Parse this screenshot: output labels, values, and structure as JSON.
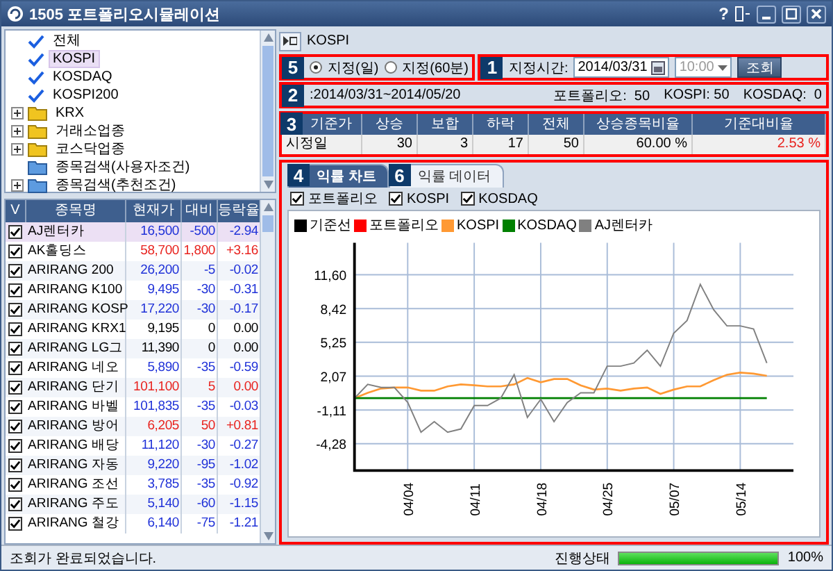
{
  "window": {
    "title": "1505 포트폴리오시뮬레이션",
    "help": "?"
  },
  "tree": [
    {
      "label": "전체",
      "kind": "check",
      "checked": true,
      "selected": false
    },
    {
      "label": "KOSPI",
      "kind": "check",
      "checked": true,
      "selected": true
    },
    {
      "label": "KOSDAQ",
      "kind": "check",
      "checked": true,
      "selected": false
    },
    {
      "label": "KOSPI200",
      "kind": "check",
      "checked": true,
      "selected": false
    },
    {
      "label": "KRX",
      "kind": "folder",
      "expandable": true,
      "selected": false
    },
    {
      "label": "거래소업종",
      "kind": "folder",
      "expandable": true,
      "selected": false
    },
    {
      "label": "코스닥업종",
      "kind": "folder",
      "expandable": true,
      "selected": false
    },
    {
      "label": "종목검색(사용자조건)",
      "kind": "search",
      "expandable": false,
      "selected": false
    },
    {
      "label": "종목검색(추천조건)",
      "kind": "search",
      "expandable": true,
      "selected": false
    }
  ],
  "stocks": {
    "columns": [
      "V",
      "종목명",
      "현재가",
      "대비",
      "등락율"
    ],
    "rows": [
      {
        "checked": true,
        "selected": true,
        "color": "#1f31d8",
        "name": "AJ렌터카",
        "price": "16,500",
        "change": "-500",
        "rate": "-2.94"
      },
      {
        "checked": true,
        "selected": false,
        "color": "#e8231f",
        "name": "AK홀딩스",
        "price": "58,700",
        "change": "1,800",
        "rate": "+3.16"
      },
      {
        "checked": true,
        "selected": false,
        "color": "#1f31d8",
        "name": "ARIRANG 200",
        "price": "26,200",
        "change": "-5",
        "rate": "-0.02"
      },
      {
        "checked": true,
        "selected": false,
        "color": "#1f31d8",
        "name": "ARIRANG K100",
        "price": "9,495",
        "change": "-30",
        "rate": "-0.31"
      },
      {
        "checked": true,
        "selected": false,
        "color": "#1f31d8",
        "name": "ARIRANG KOSP",
        "price": "17,220",
        "change": "-30",
        "rate": "-0.17"
      },
      {
        "checked": true,
        "selected": false,
        "color": "#000000",
        "name": "ARIRANG KRX1",
        "price": "9,195",
        "change": "0",
        "rate": "0.00"
      },
      {
        "checked": true,
        "selected": false,
        "color": "#000000",
        "name": "ARIRANG LG그",
        "price": "11,390",
        "change": "0",
        "rate": "0.00"
      },
      {
        "checked": true,
        "selected": false,
        "color": "#1f31d8",
        "name": "ARIRANG 네오",
        "price": "5,890",
        "change": "-35",
        "rate": "-0.59"
      },
      {
        "checked": true,
        "selected": false,
        "color": "#e8231f",
        "name": "ARIRANG 단기",
        "price": "101,100",
        "change": "5",
        "rate": "0.00"
      },
      {
        "checked": true,
        "selected": false,
        "color": "#1f31d8",
        "name": "ARIRANG 바벨",
        "price": "101,835",
        "change": "-35",
        "rate": "-0.03"
      },
      {
        "checked": true,
        "selected": false,
        "color": "#e8231f",
        "name": "ARIRANG 방어",
        "price": "6,205",
        "change": "50",
        "rate": "+0.81"
      },
      {
        "checked": true,
        "selected": false,
        "color": "#1f31d8",
        "name": "ARIRANG 배당",
        "price": "11,120",
        "change": "-30",
        "rate": "-0.27"
      },
      {
        "checked": true,
        "selected": false,
        "color": "#1f31d8",
        "name": "ARIRANG 자동",
        "price": "9,220",
        "change": "-95",
        "rate": "-1.02"
      },
      {
        "checked": true,
        "selected": false,
        "color": "#1f31d8",
        "name": "ARIRANG 조선",
        "price": "3,785",
        "change": "-35",
        "rate": "-0.92"
      },
      {
        "checked": true,
        "selected": false,
        "color": "#1f31d8",
        "name": "ARIRANG 주도",
        "price": "5,140",
        "change": "-60",
        "rate": "-1.15"
      },
      {
        "checked": true,
        "selected": false,
        "color": "#1f31d8",
        "name": "ARIRANG 철강",
        "price": "6,140",
        "change": "-75",
        "rate": "-1.21"
      }
    ]
  },
  "header": {
    "market": "KOSPI"
  },
  "badges": [
    "5",
    "1",
    "2",
    "3",
    "4",
    "6"
  ],
  "query": {
    "radios": [
      {
        "label": "지정(일)",
        "selected": true
      },
      {
        "label": "지정(60분)",
        "selected": false
      }
    ],
    "time_label": "지정시간:",
    "date": "2014/03/31",
    "time": "10:00",
    "time_disabled": true,
    "button": "조회"
  },
  "period": {
    "range": ":2014/03/31~2014/05/20",
    "counts": [
      "포트폴리오:  50",
      "KOSPI: 50",
      "KOSDAQ:  0"
    ]
  },
  "summary": {
    "columns": [
      "기준가",
      "상승",
      "보합",
      "하락",
      "전체",
      "상승종목비율",
      "기준대비율"
    ],
    "row": [
      {
        "text": "시정일",
        "color": "#000000"
      },
      {
        "text": "30",
        "color": "#000000"
      },
      {
        "text": "3",
        "color": "#000000"
      },
      {
        "text": "17",
        "color": "#000000"
      },
      {
        "text": "50",
        "color": "#000000"
      },
      {
        "text": "60.00 %",
        "color": "#000000"
      },
      {
        "text": "2.53 %",
        "color": "#e8231f"
      }
    ]
  },
  "tabs": [
    {
      "label": "익률 차트",
      "selected": true
    },
    {
      "label": "익률 데이터",
      "selected": false
    }
  ],
  "toggles": [
    {
      "label": "포트폴리오",
      "checked": true
    },
    {
      "label": "KOSPI",
      "checked": true
    },
    {
      "label": "KOSDAQ",
      "checked": true
    }
  ],
  "chart": {
    "chart_data": {
      "type": "line",
      "categories": [
        null,
        null,
        null,
        null,
        "04/04",
        null,
        null,
        null,
        null,
        "04/11",
        null,
        null,
        null,
        null,
        "04/18",
        null,
        null,
        null,
        null,
        "04/25",
        null,
        null,
        null,
        null,
        "05/07",
        null,
        null,
        null,
        null,
        "05/14",
        null,
        null
      ],
      "ylim": [
        -6.8,
        14.6
      ],
      "grid": true,
      "yticks": [
        {
          "value": -4.28,
          "label": "-4,28"
        },
        {
          "value": -1.11,
          "label": "-1,11"
        },
        {
          "value": 2.07,
          "label": "2,07"
        },
        {
          "value": 5.25,
          "label": "5,25"
        },
        {
          "value": 8.42,
          "label": "8,42"
        },
        {
          "value": 11.6,
          "label": "11,60"
        }
      ],
      "series": [
        {
          "name": "기준선",
          "color": "#000000",
          "values": [
            null,
            null,
            null,
            null,
            null,
            null,
            null,
            null,
            null,
            null,
            null,
            null,
            null,
            null,
            null,
            null,
            null,
            null,
            null,
            null,
            null,
            null,
            null,
            null,
            null,
            null,
            null,
            null,
            null,
            null,
            null,
            null
          ]
        },
        {
          "name": "포트폴리오",
          "color": "#ff0000",
          "values": [
            null,
            null,
            null,
            null,
            null,
            null,
            null,
            null,
            null,
            null,
            null,
            null,
            null,
            null,
            null,
            null,
            null,
            null,
            null,
            null,
            null,
            null,
            null,
            null,
            null,
            null,
            null,
            null,
            null,
            null,
            null,
            null
          ]
        },
        {
          "name": "KOSPI",
          "color": "#ff9933",
          "values": [
            0,
            0.5,
            0.9,
            1.0,
            1.0,
            0.7,
            0.7,
            1.1,
            1.3,
            1.2,
            1.1,
            1.1,
            1.3,
            1.9,
            1.5,
            1.8,
            1.8,
            1.2,
            0.8,
            0.9,
            0.7,
            0.9,
            1.0,
            0.4,
            0.8,
            1.1,
            1.1,
            1.7,
            2.2,
            2.4,
            2.3,
            2.1
          ]
        },
        {
          "name": "KOSDAQ",
          "color": "#008000",
          "values": [
            0,
            0,
            0,
            0,
            0,
            0,
            0,
            0,
            0,
            0,
            0,
            0,
            0,
            0,
            0,
            0,
            0,
            0,
            0,
            0,
            0,
            0,
            0,
            0,
            0,
            0,
            0,
            0,
            0,
            0,
            0,
            0
          ]
        },
        {
          "name": "AJ렌터카",
          "color": "#808080",
          "values": [
            0,
            1.3,
            1.0,
            1.0,
            -0.4,
            -3.2,
            -2.2,
            -3.2,
            -2.9,
            -0.7,
            -0.7,
            0.0,
            2.2,
            -1.8,
            -0.1,
            -2.2,
            -0.4,
            0.5,
            0.5,
            3.0,
            3.0,
            3.3,
            4.5,
            3.0,
            6.1,
            7.3,
            10.7,
            8.3,
            6.8,
            6.8,
            6.5,
            3.3
          ]
        }
      ]
    }
  },
  "status": {
    "message": "조회가 완료되었습니다.",
    "progress_label": "진행상태",
    "level": 1,
    "percent": "100%"
  }
}
